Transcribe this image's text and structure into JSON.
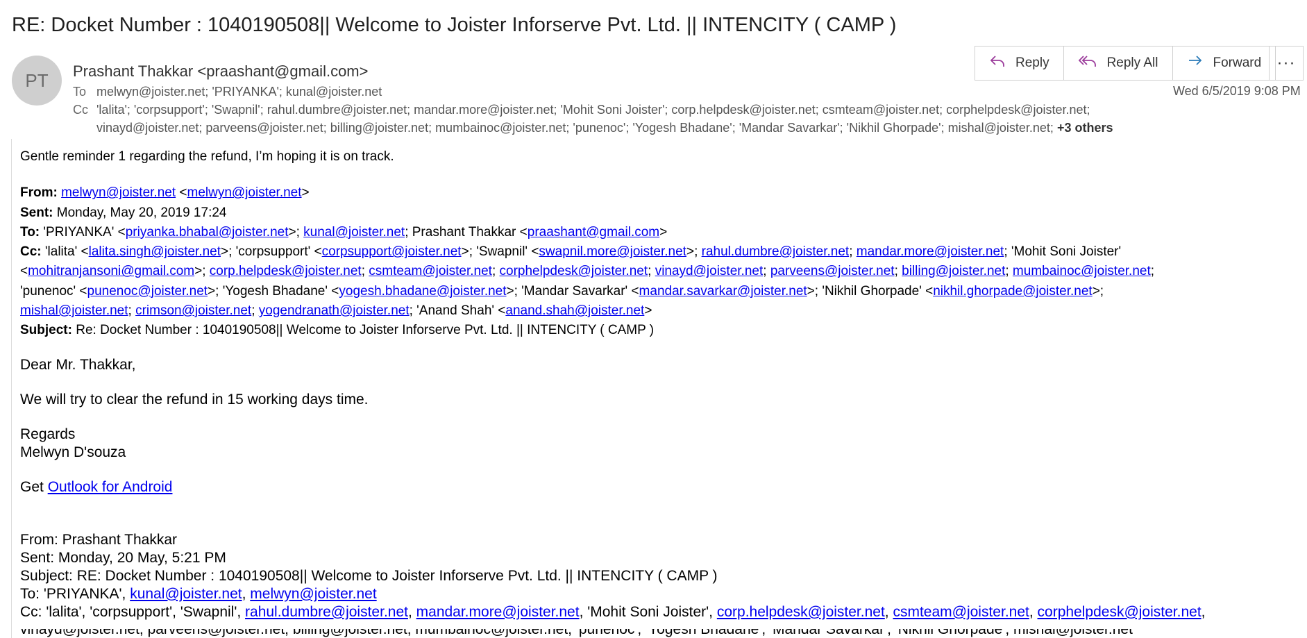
{
  "subject": "RE: Docket Number : 1040190508|| Welcome to Joister Inforserve Pvt. Ltd. || INTENCITY ( CAMP )",
  "avatar_initials": "PT",
  "sender": "Prashant Thakkar <praashant@gmail.com>",
  "header": {
    "to_label": "To",
    "to_value": "melwyn@joister.net; 'PRIYANKA'; kunal@joister.net",
    "cc_label": "Cc",
    "cc_line1": "'lalita'; 'corpsupport'; 'Swapnil'; rahul.dumbre@joister.net; mandar.more@joister.net; 'Mohit Soni Joister'; corp.helpdesk@joister.net; csmteam@joister.net; corphelpdesk@joister.net;",
    "cc_line2": "vinayd@joister.net; parveens@joister.net; billing@joister.net; mumbainoc@joister.net; 'punenoc'; 'Yogesh Bhadane'; 'Mandar Savarkar'; 'Nikhil Ghorpade'; mishal@joister.net;",
    "cc_more": "+3 others",
    "date": "Wed 6/5/2019 9:08 PM"
  },
  "actions": {
    "reply": "Reply",
    "reply_all": "Reply All",
    "forward": "Forward",
    "more": "···"
  },
  "body": {
    "reminder": "Gentle reminder 1 regarding the refund, I’m hoping it is on track.",
    "quoted1": {
      "from_label": "From:",
      "from_link1": "melwyn@joister.net",
      "from_link2": "melwyn@joister.net",
      "sent_label": "Sent:",
      "sent_value": "Monday, May 20, 2019 17:24",
      "to_label": "To:",
      "to_p1": "'PRIYANKA' <",
      "to_link1": "priyanka.bhabal@joister.net",
      "to_p2": ">; ",
      "to_link2": "kunal@joister.net",
      "to_p3": "; Prashant Thakkar <",
      "to_link3": "praashant@gmail.com",
      "cc_label": "Cc:",
      "cc_l1_p1": "'lalita' <",
      "cc_link_lalita": "lalita.singh@joister.net",
      "cc_l1_p2": ">; 'corpsupport' <",
      "cc_link_corpsupport": "corpsupport@joister.net",
      "cc_l1_p3": ">; 'Swapnil' <",
      "cc_link_swapnil": "swapnil.more@joister.net",
      "cc_link_rahul": "rahul.dumbre@joister.net",
      "cc_link_mandar": "mandar.more@joister.net",
      "cc_l1_p4": "; 'Mohit Soni Joister'",
      "cc_link_mohit": "mohitranjansoni@gmail.com",
      "cc_link_corphd": "corp.helpdesk@joister.net",
      "cc_link_csm": "csmteam@joister.net",
      "cc_link_corphd2": "corphelpdesk@joister.net",
      "cc_link_vinay": "vinayd@joister.net",
      "cc_link_parveen": "parveens@joister.net",
      "cc_link_billing": "billing@joister.net",
      "cc_link_mumbai": "mumbainoc@joister.net",
      "cc_l3_p1": "'punenoc' <",
      "cc_link_pune": "punenoc@joister.net",
      "cc_l3_p2": ">; 'Yogesh Bhadane' <",
      "cc_link_yogesh": "yogesh.bhadane@joister.net",
      "cc_l3_p3": ">; 'Mandar Savarkar' <",
      "cc_link_savarkar": "mandar.savarkar@joister.net",
      "cc_l3_p4": ">; 'Nikhil Ghorpade' <",
      "cc_link_nikhil": "nikhil.ghorpade@joister.net",
      "cc_link_mishal": "mishal@joister.net",
      "cc_link_crimson": "crimson@joister.net",
      "cc_link_yogen": "yogendranath@joister.net",
      "cc_l4_p1": "; 'Anand Shah' <",
      "cc_link_anand": "anand.shah@joister.net",
      "subject_label": "Subject:",
      "subject_value": "Re: Docket Number : 1040190508|| Welcome to Joister Inforserve Pvt. Ltd. || INTENCITY ( CAMP )"
    },
    "greeting": "Dear Mr. Thakkar,",
    "message": "We will try to clear the refund in 15 working days time.",
    "regards": "Regards",
    "signature": "Melwyn D'souza",
    "get_prefix": "Get ",
    "outlook_link": "Outlook for Android",
    "quoted2": {
      "from": "From: Prashant Thakkar",
      "sent": "Sent: Monday, 20 May, 5:21 PM",
      "subject": "Subject: RE: Docket Number : 1040190508|| Welcome to Joister Inforserve Pvt. Ltd. || INTENCITY ( CAMP )",
      "to_prefix": "To: 'PRIYANKA', ",
      "to_link1": "kunal@joister.net",
      "to_link2": "melwyn@joister.net",
      "cc_prefix": "Cc: 'lalita', 'corpsupport', 'Swapnil', ",
      "cc_link1": "rahul.dumbre@joister.net",
      "cc_link2": "mandar.more@joister.net",
      "cc_mid": ", 'Mohit Soni Joister', ",
      "cc_link3": "corp.helpdesk@joister.net",
      "cc_link4": "csmteam@joister.net",
      "cc_link5": "corphelpdesk@joister.net",
      "cut_line": "vinayd@joister.net, parveens@joister.net, billing@joister.net, mumbainoc@joister.net, 'punenoc', 'Yogesh Bhadane', 'Mandar Savarkar', 'Nikhil Ghorpade', mishal@joister.net"
    }
  }
}
